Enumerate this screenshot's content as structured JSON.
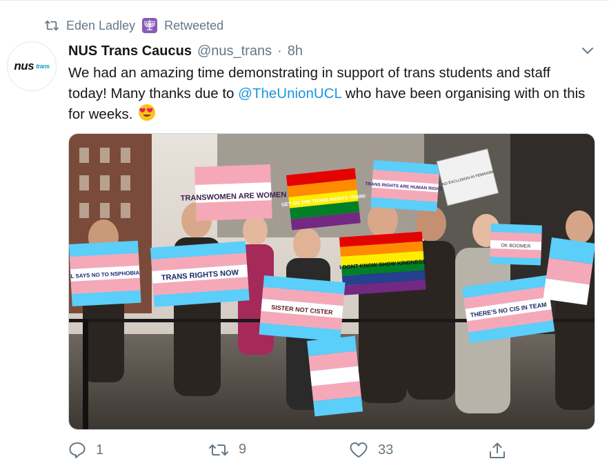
{
  "retweet": {
    "user_name": "Eden Ladley",
    "label": "Retweeted",
    "icons": [
      "retweet-icon",
      "menorah-emoji-icon"
    ]
  },
  "tweet": {
    "avatar_text": "nus",
    "avatar_subtext": "trans",
    "display_name": "NUS Trans Caucus",
    "handle": "@nus_trans",
    "separator": "·",
    "time": "8h",
    "text_before_mention": "We had an amazing time demonstrating in support of trans students and staff today! Many thanks due to ",
    "mention": "@TheUnionUCL",
    "text_after_mention": " who have been organising with on this for weeks.",
    "emoji": "heart-eyes-emoji"
  },
  "photo": {
    "signs": {
      "transwomen": "TRANSWOMEN ARE WOMEN",
      "get_on_train": "GET ON THE TRANS RIGHTS TRAIN!",
      "trans_rights_are_human": "TRANS RIGHTS ARE HUMAN RIGHTS",
      "no_exclusion": "NO EXCLUSION IN FEMINISM",
      "says_no_to_transphobia": "L SAYS NO TO NSPHOBIA",
      "trans_rights_now": "TRANS RIGHTS NOW",
      "sister_not_cister": "SISTER NOT CISTER",
      "dont_know_show_kindness": "I DONT KNOW SHOW KINDNESS",
      "theres_no_cis_in_team": "THERE'S NO CIS IN TEAM",
      "ok_boomer": "OK BOOMER"
    }
  },
  "actions": {
    "reply_count": "1",
    "retweet_count": "9",
    "like_count": "33",
    "icons": [
      "reply-icon",
      "retweet-icon",
      "like-icon",
      "share-icon"
    ]
  },
  "colors": {
    "accent": "#1b95e0",
    "muted": "#657786",
    "trans_blue": "#5bcefa",
    "trans_pink": "#f5a9b8"
  }
}
